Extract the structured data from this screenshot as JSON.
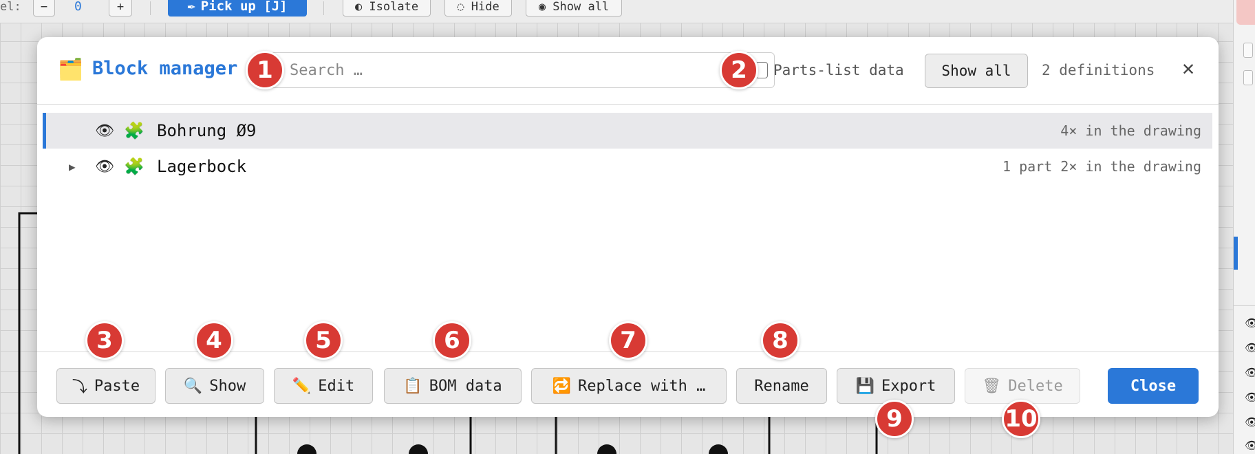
{
  "toolbar": {
    "label": "el:",
    "minus": "−",
    "value": "0",
    "plus": "+",
    "pickup_icon": "✒",
    "pickup_label": "Pick up [J]",
    "isolate_label": "◐ Isolate",
    "hide_label": "◌ Hide",
    "showall_label": "◉ Show all"
  },
  "dialog": {
    "title_icon": "🗂️",
    "title": "Block manager",
    "search_placeholder": "Search …",
    "parts_list_label": "Parts-list data",
    "show_all_label": "Show all",
    "definitions_count": "2 definitions",
    "close_icon": "✕",
    "blocks": [
      {
        "toggle": "",
        "eye": "👁",
        "icon": "🧩",
        "name": "Bohrung Ø9",
        "meta": "4× in the drawing",
        "selected": true
      },
      {
        "toggle": "▶",
        "eye": "👁",
        "icon": "🧩",
        "name": "Lagerbock",
        "meta": "1 part 2× in the drawing",
        "selected": false
      }
    ],
    "footer": {
      "paste": {
        "icon": "⤵",
        "label": "Paste"
      },
      "show": {
        "icon": "🔍",
        "label": "Show"
      },
      "edit": {
        "icon": "✏️",
        "label": "Edit"
      },
      "bom": {
        "icon": "📋",
        "label": "BOM data"
      },
      "replace": {
        "icon": "🔁",
        "label": "Replace with …"
      },
      "rename": {
        "label": "Rename"
      },
      "export": {
        "icon": "💾",
        "label": "Export"
      },
      "delete": {
        "icon": "🗑",
        "label": "Delete"
      },
      "close": {
        "label": "Close"
      }
    }
  },
  "badges": [
    "1",
    "2",
    "3",
    "4",
    "5",
    "6",
    "7",
    "8",
    "9",
    "10"
  ],
  "colors": {
    "accent": "#2b78d8",
    "badge": "#d83a34"
  }
}
